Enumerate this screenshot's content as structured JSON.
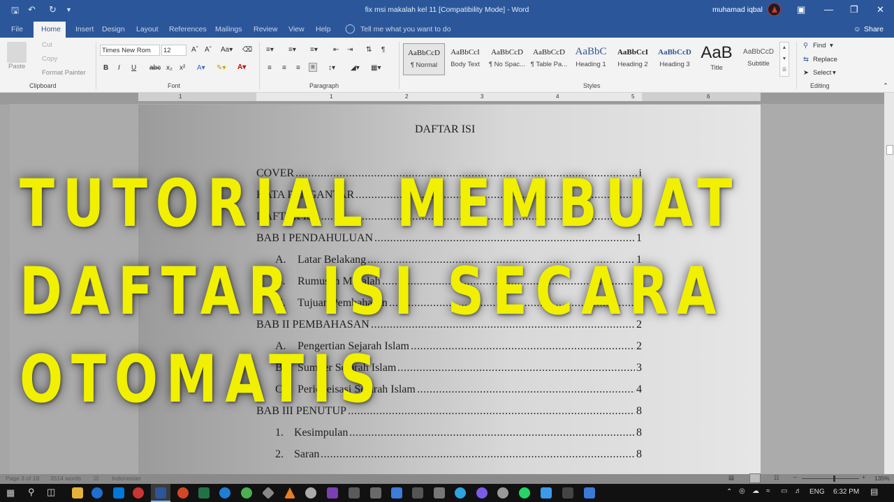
{
  "titlebar": {
    "document_title": "fix msi makalah kel 11 [Compatibility Mode]  -  Word",
    "user_name": "muhamad iqbal"
  },
  "tabs": [
    "File",
    "Home",
    "Insert",
    "Design",
    "Layout",
    "References",
    "Mailings",
    "Review",
    "View",
    "Help"
  ],
  "tell_me": "Tell me what you want to do",
  "share_label": "Share",
  "ribbon": {
    "clipboard": {
      "paste": "Paste",
      "cut": "Cut",
      "copy": "Copy",
      "format_painter": "Format Painter",
      "label": "Clipboard"
    },
    "font": {
      "name": "Times New Rom",
      "size": "12",
      "label": "Font"
    },
    "paragraph": {
      "label": "Paragraph"
    },
    "styles": {
      "label": "Styles",
      "items": [
        {
          "sample": "AaBbCcD",
          "name": "¶ Normal"
        },
        {
          "sample": "AaBbCcI",
          "name": "Body Text"
        },
        {
          "sample": "AaBbCcD",
          "name": "¶ No Spac..."
        },
        {
          "sample": "AaBbCcD",
          "name": "¶ Table Pa..."
        },
        {
          "sample": "AaBbC",
          "name": "Heading 1"
        },
        {
          "sample": "AaBbCcI",
          "name": "Heading 2"
        },
        {
          "sample": "AaBbCcD",
          "name": "Heading 3"
        },
        {
          "sample": "AaB",
          "name": "Title"
        },
        {
          "sample": "AaBbCcD",
          "name": "Subtitle"
        }
      ]
    },
    "editing": {
      "find": "Find",
      "replace": "Replace",
      "select": "Select",
      "label": "Editing"
    }
  },
  "ruler_numbers": [
    "1",
    "1",
    "2",
    "3",
    "4",
    "5",
    "6"
  ],
  "document": {
    "heading": "DAFTAR ISI",
    "toc": [
      {
        "text": "COVER",
        "page": "i"
      },
      {
        "text": "KATA PENGANTAR",
        "page": "ii"
      },
      {
        "text": "DAFTAR ISI",
        "page": "iii"
      },
      {
        "text": "BAB I PENDAHULUAN",
        "page": "1"
      },
      {
        "marker": "A.",
        "text": "Latar Belakang",
        "page": "1"
      },
      {
        "marker": "B.",
        "text": "Rumusan Masalah",
        "page": "1"
      },
      {
        "marker": "C.",
        "text": "Tujuan Pembahasan",
        "page": "1"
      },
      {
        "text": "BAB II PEMBAHASAN",
        "page": "2"
      },
      {
        "marker": "A.",
        "text": "Pengertian Sejarah Islam",
        "page": "2"
      },
      {
        "marker": "B.",
        "text": "Sumber Sejarah Islam",
        "page": "3"
      },
      {
        "marker": "C.",
        "text": "Periodeisasi Sejarah Islam",
        "page": "4"
      },
      {
        "text": "BAB III PENUTUP",
        "page": "8"
      },
      {
        "marker": "1.",
        "text": "Kesimpulan",
        "page": "8"
      },
      {
        "marker": "2.",
        "text": "Saran",
        "page": "8"
      }
    ]
  },
  "overlay": {
    "line1": "TUTORIAL MEMBUAT",
    "line2": "DAFTAR ISI SECARA",
    "line3": "OTOMATIS"
  },
  "statusbar": {
    "page": "Page 3 of 18",
    "words": "3514 words",
    "language": "Indonesian",
    "zoom": "135%"
  },
  "taskbar": {
    "language": "ENG",
    "time": "6:32 PM"
  }
}
